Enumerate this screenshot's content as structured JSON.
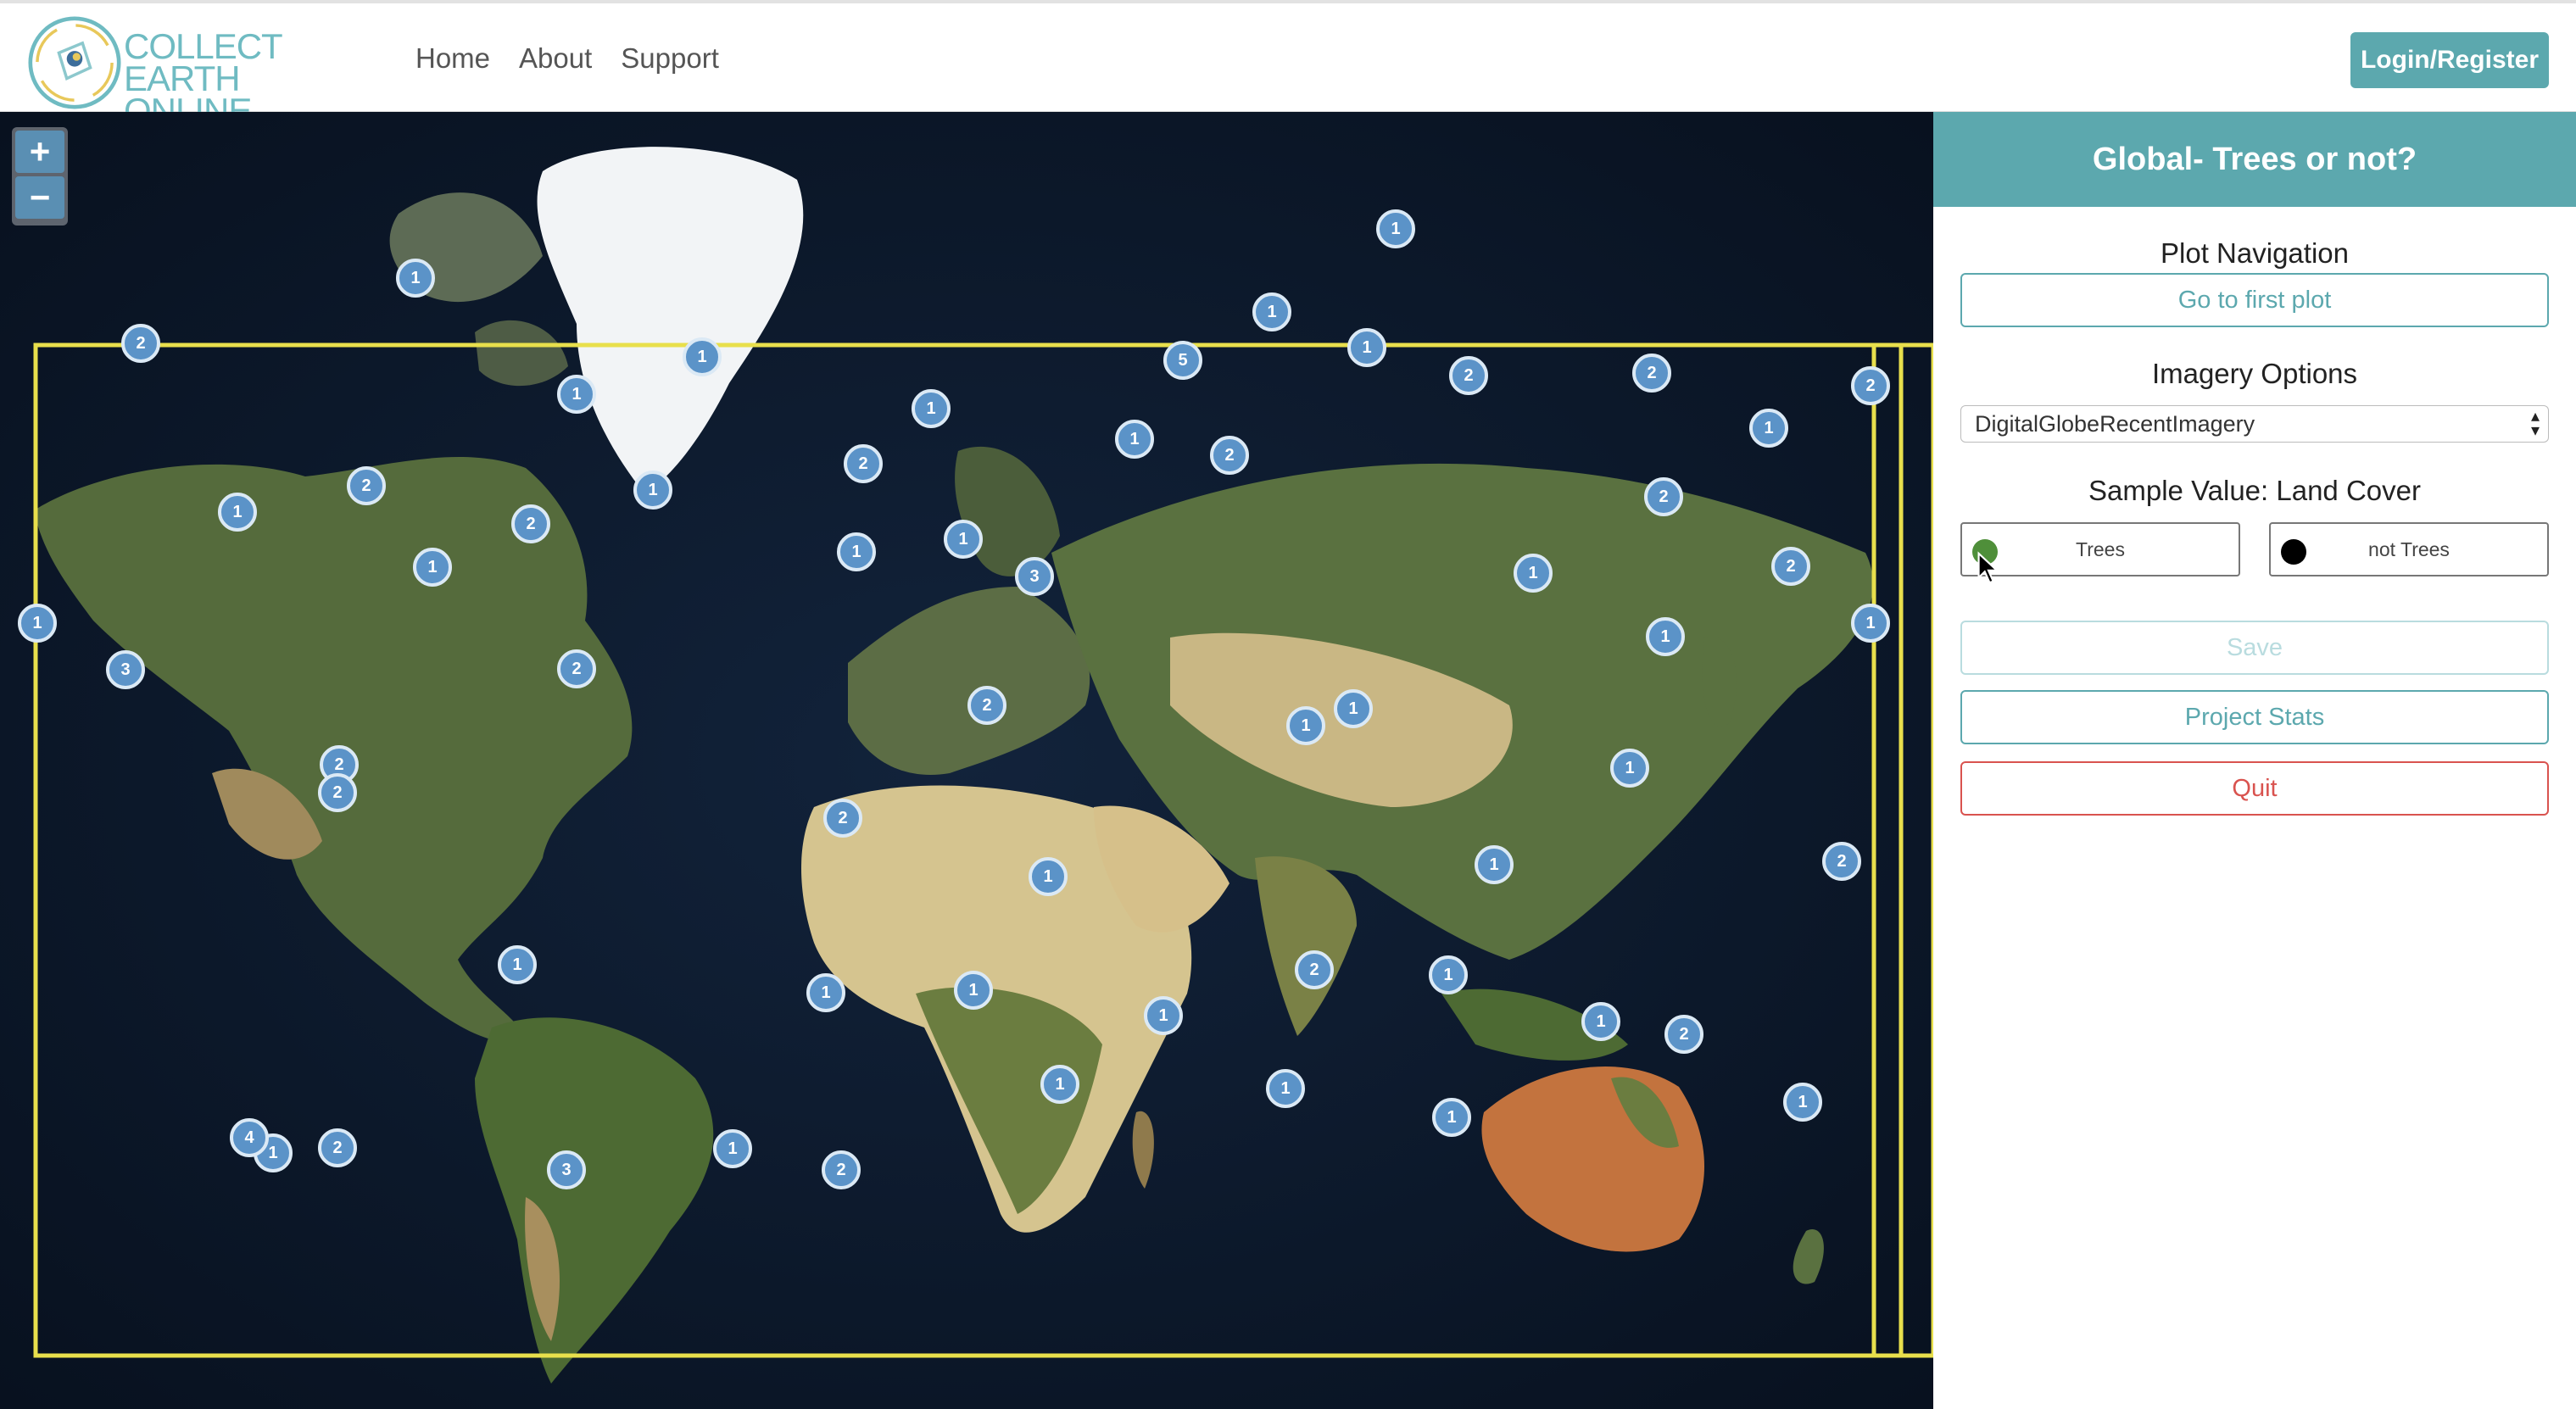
{
  "app": {
    "logo_line1": "COLLECT EARTH",
    "logo_line2": "ONLINE",
    "nav": [
      "Home",
      "About",
      "Support"
    ],
    "login_label": "Login/Register"
  },
  "map": {
    "zoom_in": "+",
    "zoom_out": "−",
    "clusters": [
      "1",
      "2",
      "3",
      "1",
      "1",
      "2",
      "1",
      "2",
      "1",
      "1",
      "1",
      "2",
      "2",
      "1",
      "2",
      "1",
      "1",
      "2",
      "1",
      "1",
      "5",
      "1",
      "2",
      "1",
      "3",
      "1",
      "2",
      "1",
      "2",
      "2",
      "1",
      "2",
      "1",
      "1",
      "2",
      "1",
      "1",
      "2",
      "2",
      "1",
      "1",
      "2",
      "1",
      "1",
      "1",
      "1",
      "1",
      "2",
      "1",
      "2",
      "1",
      "1",
      "4",
      "2",
      "3",
      "1",
      "2",
      "1",
      "1",
      "1"
    ]
  },
  "panel": {
    "title": "Global- Trees or not?",
    "plot_navigation_heading": "Plot Navigation",
    "go_first_plot": "Go to first plot",
    "imagery_heading": "Imagery Options",
    "imagery_selected": "DigitalGlobeRecentImagery",
    "sample_heading": "Sample Value: Land Cover",
    "sample_values": [
      {
        "label": "Trees",
        "color": "#4f8f3a"
      },
      {
        "label": "not Trees",
        "color": "#000000"
      }
    ],
    "save": "Save",
    "project_stats": "Project Stats",
    "quit": "Quit"
  },
  "colors": {
    "accent": "#5ca8ae",
    "quit": "#d9534f",
    "cluster": "#5b93c8",
    "plot_boundary": "#e8df4c"
  }
}
